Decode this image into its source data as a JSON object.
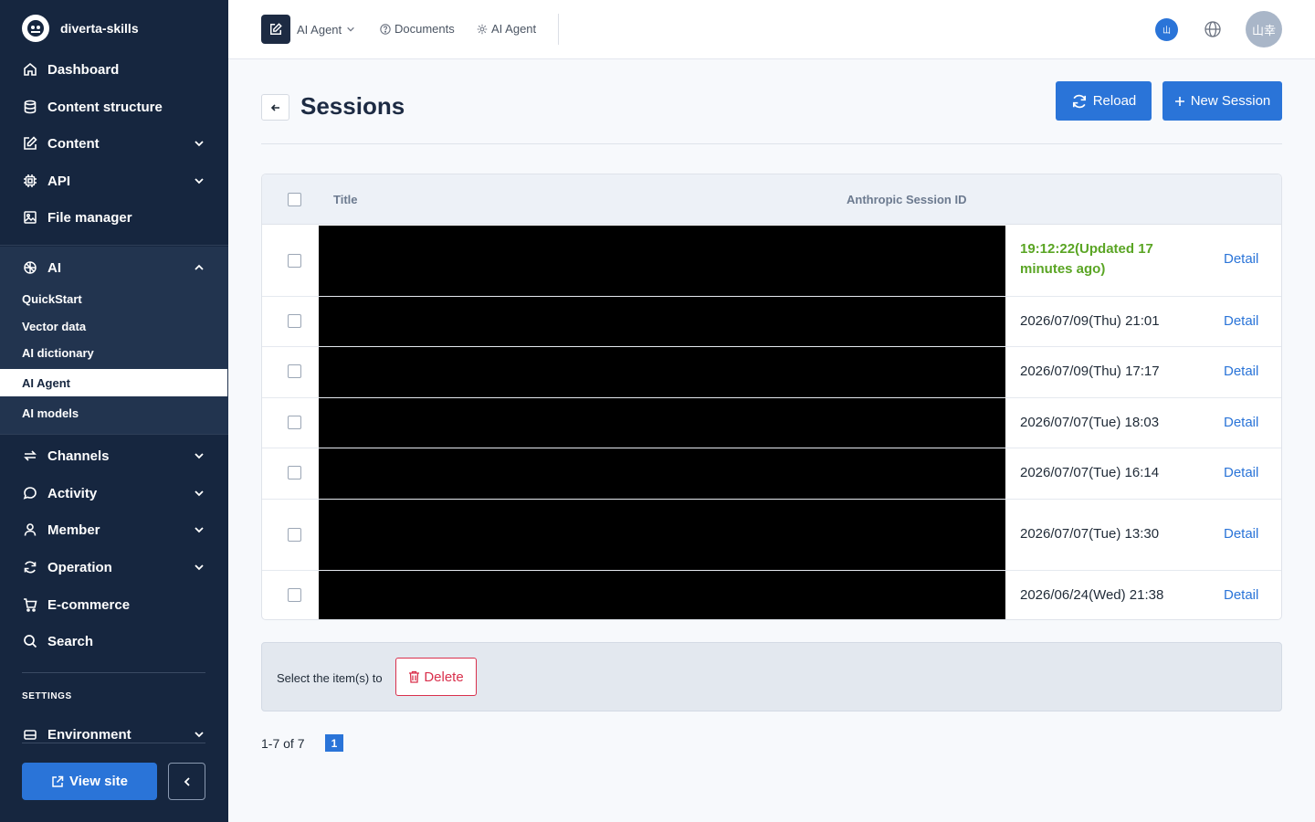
{
  "sidebar": {
    "brand": "diverta-skills",
    "items": [
      {
        "label": "Dashboard"
      },
      {
        "label": "Content structure"
      },
      {
        "label": "Content"
      },
      {
        "label": "API"
      },
      {
        "label": "File manager"
      },
      {
        "label": "AI"
      },
      {
        "label": "Channels"
      },
      {
        "label": "Activity"
      },
      {
        "label": "Member"
      },
      {
        "label": "Operation"
      },
      {
        "label": "E-commerce"
      },
      {
        "label": "Search"
      },
      {
        "label": "Environment"
      }
    ],
    "ai_sub": [
      {
        "label": "QuickStart"
      },
      {
        "label": "Vector data"
      },
      {
        "label": "AI dictionary"
      },
      {
        "label": "AI Agent"
      },
      {
        "label": "AI models"
      }
    ],
    "settings_label": "SETTINGS",
    "view_site": "View site"
  },
  "topbar": {
    "app_label": "AI Agent",
    "links": [
      {
        "label": "Documents"
      },
      {
        "label": "AI Agent"
      }
    ],
    "user_small": "山",
    "avatar": "山幸"
  },
  "page": {
    "title": "Sessions",
    "reload": "Reload",
    "new_session": "New Session"
  },
  "table": {
    "columns": {
      "title": "Title",
      "session_id": "Anthropic Session ID"
    },
    "rows": [
      {
        "date": "19:12:22(Updated 17 minutes ago)",
        "action": "Detail"
      },
      {
        "date": "2026/07/09(Thu) 21:01",
        "action": "Detail"
      },
      {
        "date": "2026/07/09(Thu) 17:17",
        "action": "Detail"
      },
      {
        "date": "2026/07/07(Tue) 18:03",
        "action": "Detail"
      },
      {
        "date": "2026/07/07(Tue) 16:14",
        "action": "Detail"
      },
      {
        "date": "2026/07/07(Tue) 13:30",
        "action": "Detail"
      },
      {
        "date": "2026/06/24(Wed) 21:38",
        "action": "Detail"
      }
    ]
  },
  "bulk": {
    "text": "Select the item(s) to",
    "delete": "Delete"
  },
  "pagination": {
    "range": "1-7 of 7",
    "current_page": "1"
  },
  "colors": {
    "sidebar_bg": "#16263f",
    "accent": "#2a74d8",
    "recent_green": "#5aa524",
    "danger": "#d9304c"
  }
}
